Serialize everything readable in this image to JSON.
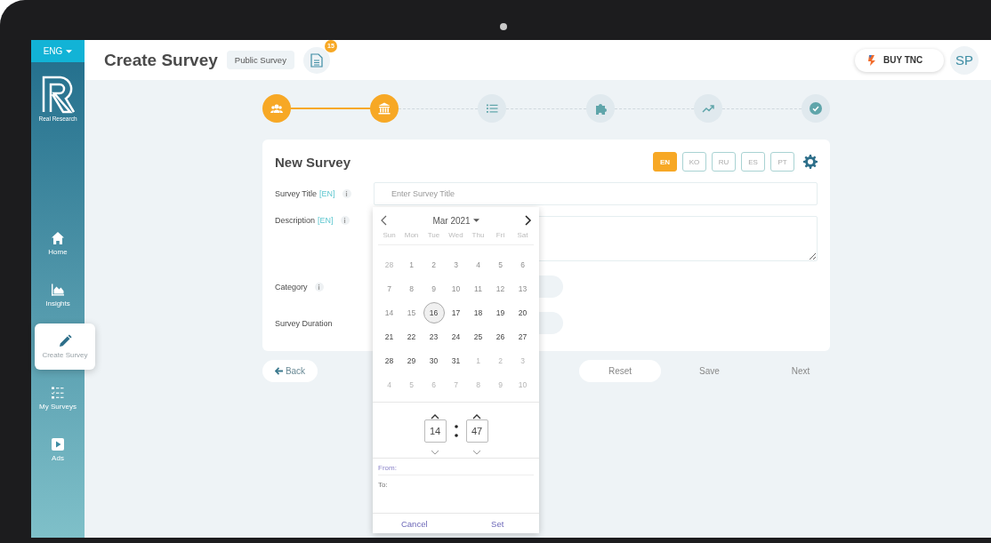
{
  "sidebar": {
    "language": "ENG",
    "logo_text": "Real Research",
    "items": [
      {
        "label": "Home",
        "selected": false
      },
      {
        "label": "Insights",
        "selected": false
      },
      {
        "label": "Create Survey",
        "selected": true
      },
      {
        "label": "My Surveys",
        "selected": false
      },
      {
        "label": "Ads",
        "selected": false
      }
    ]
  },
  "header": {
    "title": "Create Survey",
    "badge": "Public Survey",
    "document_count": "15",
    "buy_button": "BUY TNC",
    "avatar": "SP"
  },
  "steps": [
    {
      "done": true
    },
    {
      "done": true
    },
    {
      "done": false
    },
    {
      "done": false
    },
    {
      "done": false
    },
    {
      "done": false
    }
  ],
  "card": {
    "title": "New Survey",
    "languages": [
      {
        "label": "EN",
        "selected": true
      },
      {
        "label": "KO",
        "selected": false
      },
      {
        "label": "RU",
        "selected": false
      },
      {
        "label": "ES",
        "selected": false
      },
      {
        "label": "PT",
        "selected": false
      }
    ],
    "fields": [
      {
        "label": "Survey Title",
        "tag": "[EN]",
        "info": true,
        "kind": "input",
        "placeholder": "Enter Survey Title"
      },
      {
        "label": "Description",
        "tag": "[EN]",
        "info": true,
        "kind": "textarea"
      },
      {
        "label": "Category",
        "info": true,
        "kind": "select"
      },
      {
        "label": "Survey Duration",
        "info": false,
        "kind": "select"
      }
    ]
  },
  "buttons": {
    "back": "Back",
    "reset": "Reset",
    "save": "Save",
    "next": "Next"
  },
  "date_picker": {
    "month": "Mar 2021",
    "weekdays": [
      "Sun",
      "Mon",
      "Tue",
      "Wed",
      "Thu",
      "Fri",
      "Sat"
    ],
    "weeks": [
      [
        {
          "day": "28",
          "kind": "other",
          "selected": false
        },
        {
          "day": "1",
          "kind": "disabled",
          "selected": false
        },
        {
          "day": "2",
          "kind": "disabled",
          "selected": false
        },
        {
          "day": "3",
          "kind": "disabled",
          "selected": false
        },
        {
          "day": "4",
          "kind": "disabled",
          "selected": false
        },
        {
          "day": "5",
          "kind": "disabled",
          "selected": false
        },
        {
          "day": "6",
          "kind": "disabled",
          "selected": false
        }
      ],
      [
        {
          "day": "7",
          "kind": "disabled",
          "selected": false
        },
        {
          "day": "8",
          "kind": "disabled",
          "selected": false
        },
        {
          "day": "9",
          "kind": "disabled",
          "selected": false
        },
        {
          "day": "10",
          "kind": "disabled",
          "selected": false
        },
        {
          "day": "11",
          "kind": "disabled",
          "selected": false
        },
        {
          "day": "12",
          "kind": "disabled",
          "selected": false
        },
        {
          "day": "13",
          "kind": "disabled",
          "selected": false
        }
      ],
      [
        {
          "day": "14",
          "kind": "disabled",
          "selected": false
        },
        {
          "day": "15",
          "kind": "disabled",
          "selected": false
        },
        {
          "day": "16",
          "kind": "available",
          "selected": true
        },
        {
          "day": "17",
          "kind": "available",
          "selected": false
        },
        {
          "day": "18",
          "kind": "available",
          "selected": false
        },
        {
          "day": "19",
          "kind": "available",
          "selected": false
        },
        {
          "day": "20",
          "kind": "available",
          "selected": false
        }
      ],
      [
        {
          "day": "21",
          "kind": "available",
          "selected": false
        },
        {
          "day": "22",
          "kind": "available",
          "selected": false
        },
        {
          "day": "23",
          "kind": "available",
          "selected": false
        },
        {
          "day": "24",
          "kind": "available",
          "selected": false
        },
        {
          "day": "25",
          "kind": "available",
          "selected": false
        },
        {
          "day": "26",
          "kind": "available",
          "selected": false
        },
        {
          "day": "27",
          "kind": "available",
          "selected": false
        }
      ],
      [
        {
          "day": "28",
          "kind": "available",
          "selected": false
        },
        {
          "day": "29",
          "kind": "available",
          "selected": false
        },
        {
          "day": "30",
          "kind": "available",
          "selected": false
        },
        {
          "day": "31",
          "kind": "available",
          "selected": false
        },
        {
          "day": "1",
          "kind": "other",
          "selected": false
        },
        {
          "day": "2",
          "kind": "other",
          "selected": false
        },
        {
          "day": "3",
          "kind": "other",
          "selected": false
        }
      ],
      [
        {
          "day": "4",
          "kind": "other",
          "selected": false
        },
        {
          "day": "5",
          "kind": "other",
          "selected": false
        },
        {
          "day": "6",
          "kind": "other",
          "selected": false
        },
        {
          "day": "7",
          "kind": "other",
          "selected": false
        },
        {
          "day": "8",
          "kind": "other",
          "selected": false
        },
        {
          "day": "9",
          "kind": "other",
          "selected": false
        },
        {
          "day": "10",
          "kind": "other",
          "selected": false
        }
      ]
    ],
    "hours": "14",
    "minutes": "47",
    "from_label": "From:",
    "to_label": "To:",
    "cancel": "Cancel",
    "set": "Set"
  }
}
